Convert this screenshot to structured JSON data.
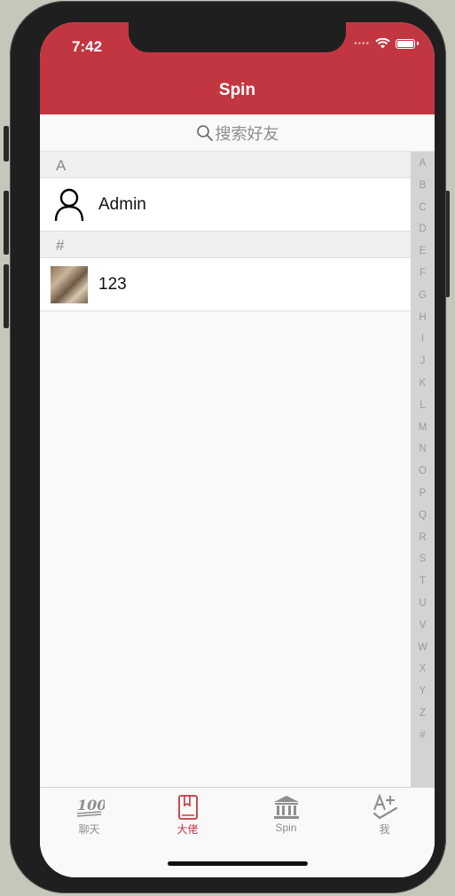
{
  "status_bar": {
    "time": "7:42"
  },
  "nav": {
    "title": "Spin"
  },
  "search": {
    "placeholder": "搜索好友"
  },
  "sections": [
    {
      "header": "A",
      "items": [
        {
          "name": "Admin",
          "avatar": "person-outline-icon"
        }
      ]
    },
    {
      "header": "#",
      "items": [
        {
          "name": "123",
          "avatar": "photo-thumbnail"
        }
      ]
    }
  ],
  "index_letters": [
    "A",
    "B",
    "C",
    "D",
    "E",
    "F",
    "G",
    "H",
    "I",
    "J",
    "K",
    "L",
    "M",
    "N",
    "O",
    "P",
    "Q",
    "R",
    "S",
    "T",
    "U",
    "V",
    "W",
    "X",
    "Y",
    "Z",
    "#"
  ],
  "tabs": [
    {
      "label": "聊天",
      "icon": "hundred-icon",
      "active": false
    },
    {
      "label": "大佬",
      "icon": "notebook-icon",
      "active": true
    },
    {
      "label": "Spin",
      "icon": "bank-icon",
      "active": false
    },
    {
      "label": "我",
      "icon": "grade-a-plus-icon",
      "active": false
    }
  ],
  "colors": {
    "accent": "#c23642",
    "inactive": "#8e8e8e"
  }
}
